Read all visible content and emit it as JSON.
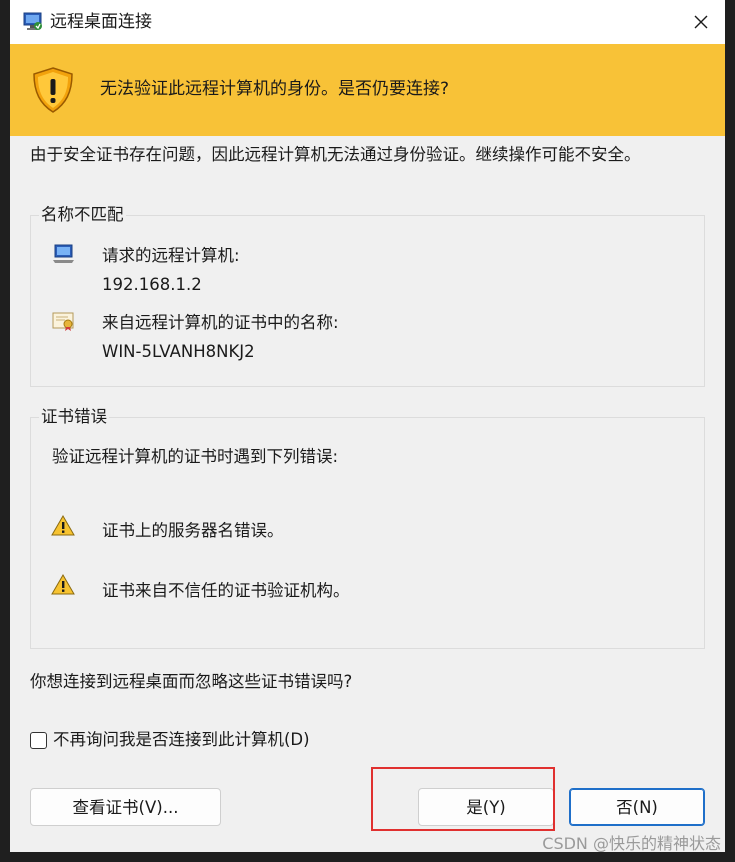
{
  "window": {
    "title": "远程桌面连接",
    "icon": "remote-desktop-icon",
    "close_icon": "close-icon"
  },
  "banner": {
    "icon": "warning-shield-icon",
    "text": "无法验证此远程计算机的身份。是否仍要连接?"
  },
  "intro": "由于安全证书存在问题，因此远程计算机无法通过身份验证。继续操作可能不安全。",
  "name_mismatch": {
    "legend": "名称不匹配",
    "requested_label": "请求的远程计算机:",
    "requested_value": "192.168.1.2",
    "cert_name_label": "来自远程计算机的证书中的名称:",
    "cert_name_value": "WIN-5LVANH8NKJ2"
  },
  "cert_errors": {
    "legend": "证书错误",
    "intro": "验证远程计算机的证书时遇到下列错误:",
    "errors": [
      "证书上的服务器名错误。",
      "证书来自不信任的证书验证机构。"
    ]
  },
  "question": "你想连接到远程桌面而忽略这些证书错误吗?",
  "checkbox": {
    "label": "不再询问我是否连接到此计算机(D)",
    "checked": false
  },
  "buttons": {
    "view_cert": "查看证书(V)...",
    "yes": "是(Y)",
    "no": "否(N)"
  },
  "watermark": "CSDN @快乐的精神状态",
  "colors": {
    "banner": "#f8c237",
    "highlight": "#e0302f",
    "default_button_border": "#1f6fc9"
  }
}
